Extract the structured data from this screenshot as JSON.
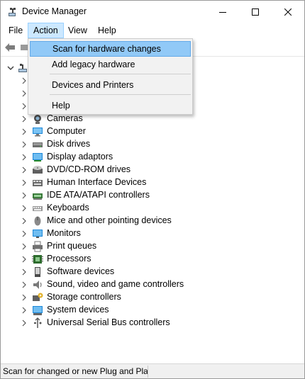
{
  "window": {
    "title": "Device Manager",
    "controls": [
      "minimize",
      "maximize",
      "close"
    ]
  },
  "menubar": {
    "file": "File",
    "action": "Action",
    "view": "View",
    "help": "Help"
  },
  "toolbar": {
    "back_icon": "back-arrow-icon",
    "forward_icon": "properties-icon"
  },
  "action_menu": {
    "items": [
      {
        "label": "Scan for hardware changes",
        "highlighted": true
      },
      {
        "label": "Add legacy hardware"
      },
      {
        "label": "Devices and Printers"
      },
      {
        "label": "Help"
      }
    ]
  },
  "tree": {
    "root_expanded": true,
    "devices": [
      {
        "label": "Cameras",
        "icon": "camera-icon"
      },
      {
        "label": "Computer",
        "icon": "computer-icon"
      },
      {
        "label": "Disk drives",
        "icon": "disk-drive-icon"
      },
      {
        "label": "Display adaptors",
        "icon": "display-adapter-icon"
      },
      {
        "label": "DVD/CD-ROM drives",
        "icon": "dvd-drive-icon"
      },
      {
        "label": "Human Interface Devices",
        "icon": "hid-icon"
      },
      {
        "label": "IDE ATA/ATAPI controllers",
        "icon": "ide-controller-icon"
      },
      {
        "label": "Keyboards",
        "icon": "keyboard-icon"
      },
      {
        "label": "Mice and other pointing devices",
        "icon": "mouse-icon"
      },
      {
        "label": "Monitors",
        "icon": "monitor-icon"
      },
      {
        "label": "Print queues",
        "icon": "printer-icon"
      },
      {
        "label": "Processors",
        "icon": "processor-icon"
      },
      {
        "label": "Software devices",
        "icon": "software-device-icon"
      },
      {
        "label": "Sound, video and game controllers",
        "icon": "speaker-icon"
      },
      {
        "label": "Storage controllers",
        "icon": "storage-controller-icon"
      },
      {
        "label": "System devices",
        "icon": "system-device-icon"
      },
      {
        "label": "Universal Serial Bus controllers",
        "icon": "usb-icon"
      }
    ]
  },
  "statusbar": {
    "text": "Scan for changed or new Plug and Play devices"
  },
  "colors": {
    "menu_highlight": "#cce8ff",
    "dropdown_highlight": "#91c9f7",
    "dropdown_bg": "#f2f2f2",
    "statusbar_bg": "#f0f0f0"
  }
}
